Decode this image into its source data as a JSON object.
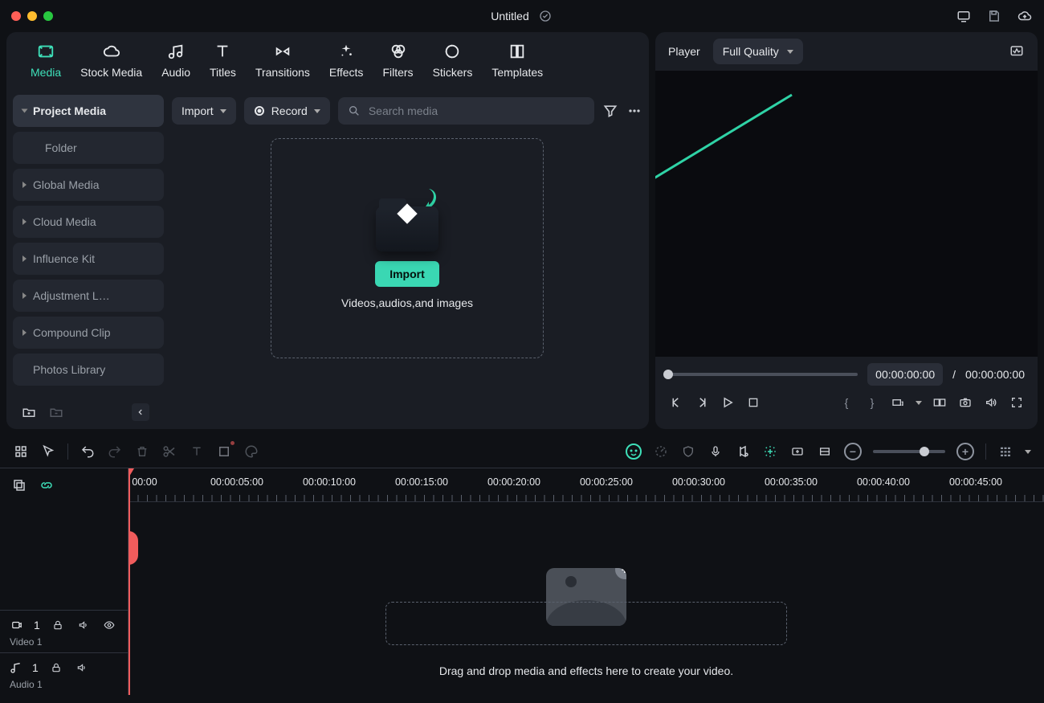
{
  "title": "Untitled",
  "tabs": {
    "media": "Media",
    "stock": "Stock Media",
    "audio": "Audio",
    "titles": "Titles",
    "transitions": "Transitions",
    "effects": "Effects",
    "filters": "Filters",
    "stickers": "Stickers",
    "templates": "Templates"
  },
  "sidebar": {
    "items": [
      "Project Media",
      "Folder",
      "Global Media",
      "Cloud Media",
      "Influence Kit",
      "Adjustment L…",
      "Compound Clip",
      "Photos Library"
    ]
  },
  "lib_toolbar": {
    "import": "Import",
    "record": "Record",
    "search_placeholder": "Search media"
  },
  "dropzone": {
    "button": "Import",
    "hint": "Videos,audios,and images"
  },
  "player": {
    "label": "Player",
    "quality": "Full Quality",
    "time_current": "00:00:00:00",
    "time_separator": "/",
    "time_total": "00:00:00:00"
  },
  "ruler": [
    "00:00",
    "00:00:05:00",
    "00:00:10:00",
    "00:00:15:00",
    "00:00:20:00",
    "00:00:25:00",
    "00:00:30:00",
    "00:00:35:00",
    "00:00:40:00",
    "00:00:45:00"
  ],
  "tracks": {
    "video": {
      "badge": "1",
      "label": "Video 1"
    },
    "audio": {
      "badge": "1",
      "label": "Audio 1"
    }
  },
  "timeline_hint": "Drag and drop media and effects here to create your video.",
  "colors": {
    "accent": "#3ad7b3"
  }
}
